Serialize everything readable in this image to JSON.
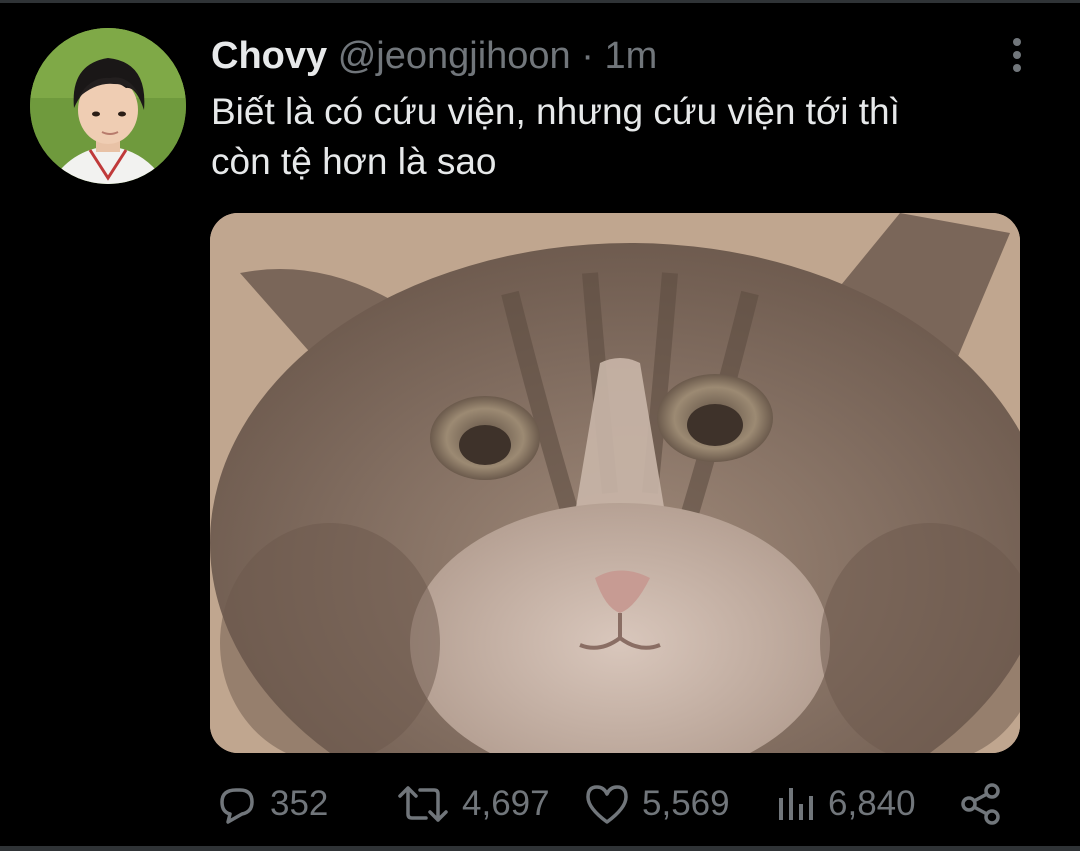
{
  "tweet": {
    "display_name": "Chovy",
    "handle": "@jeongjihoon",
    "separator": "·",
    "time": "1m",
    "text_line1": "Biết là có cứu viện, nhưng cứu viện tới thì",
    "text_line2": "còn tệ hơn là sao"
  },
  "actions": {
    "replies": "352",
    "retweets": "4,697",
    "likes": "5,569",
    "views": "6,840"
  },
  "icons": {
    "more": "more-vertical-icon",
    "reply": "speech-bubble-icon",
    "retweet": "retweet-arrows-icon",
    "like": "heart-icon",
    "views": "bar-chart-icon",
    "share": "share-icon"
  },
  "colors": {
    "background": "#000000",
    "text": "#e7e9ea",
    "muted": "#71767b"
  }
}
